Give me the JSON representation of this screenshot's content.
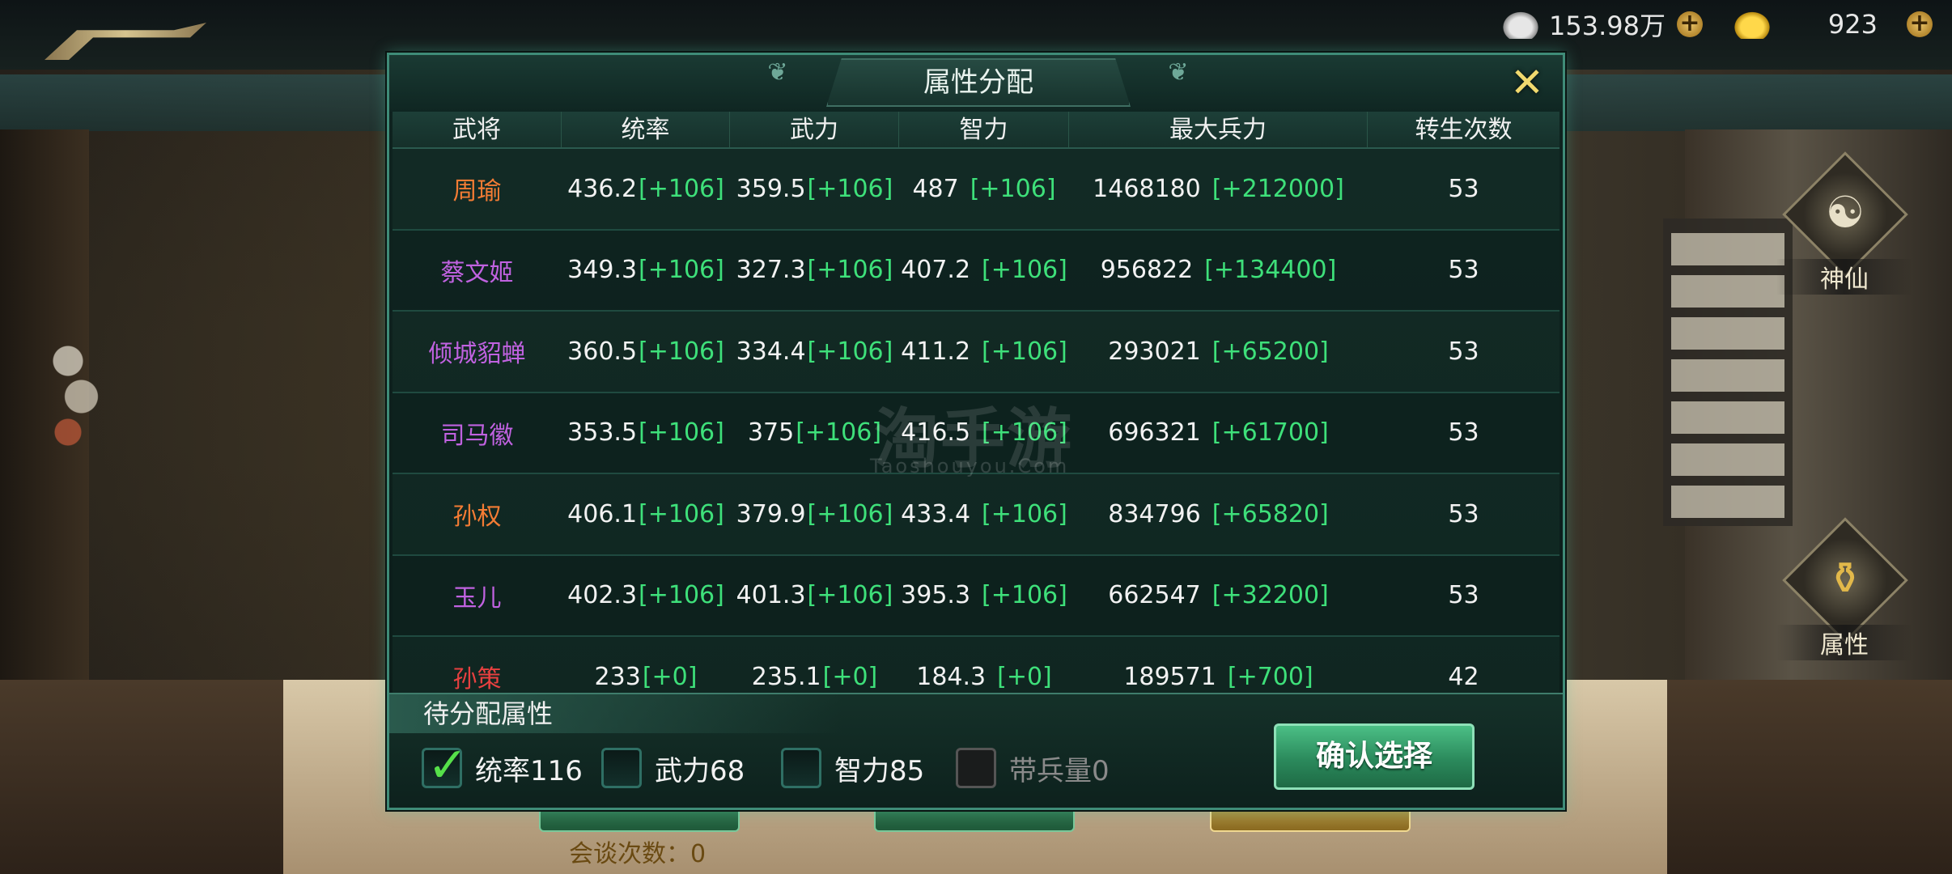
{
  "resources": {
    "silver_value": "153.98万",
    "gold_value": "923"
  },
  "side_buttons": [
    {
      "label": "神仙"
    },
    {
      "label": "属性"
    }
  ],
  "background": {
    "talk_count": "会谈次数：0",
    "watermark": "淘手游",
    "watermark_sub": "Taoshouyou.Com"
  },
  "dialog": {
    "title": "属性分配",
    "close_icon": "close-x-icon",
    "columns": [
      "武将",
      "统率",
      "武力",
      "智力",
      "最大兵力",
      "转生次数"
    ],
    "rows": [
      {
        "name": "周瑜",
        "name_color": "orange",
        "tong": "436.2",
        "tong_bonus": "[+106]",
        "wu": "359.5",
        "wu_bonus": "[+106]",
        "zhi": "487",
        "zhi_bonus": "[+106]",
        "bing": "1468180",
        "bing_bonus": "[+212000]",
        "zhuansheng": "53"
      },
      {
        "name": "蔡文姬",
        "name_color": "purple",
        "tong": "349.3",
        "tong_bonus": "[+106]",
        "wu": "327.3",
        "wu_bonus": "[+106]",
        "zhi": "407.2",
        "zhi_bonus": "[+106]",
        "bing": "956822",
        "bing_bonus": "[+134400]",
        "zhuansheng": "53"
      },
      {
        "name": "倾城貂蝉",
        "name_color": "purple",
        "tong": "360.5",
        "tong_bonus": "[+106]",
        "wu": "334.4",
        "wu_bonus": "[+106]",
        "zhi": "411.2",
        "zhi_bonus": "[+106]",
        "bing": "293021",
        "bing_bonus": "[+65200]",
        "zhuansheng": "53"
      },
      {
        "name": "司马徽",
        "name_color": "purple",
        "tong": "353.5",
        "tong_bonus": "[+106]",
        "wu": "375",
        "wu_bonus": "[+106]",
        "zhi": "416.5",
        "zhi_bonus": "[+106]",
        "bing": "696321",
        "bing_bonus": "[+61700]",
        "zhuansheng": "53"
      },
      {
        "name": "孙权",
        "name_color": "orange",
        "tong": "406.1",
        "tong_bonus": "[+106]",
        "wu": "379.9",
        "wu_bonus": "[+106]",
        "zhi": "433.4",
        "zhi_bonus": "[+106]",
        "bing": "834796",
        "bing_bonus": "[+65820]",
        "zhuansheng": "53"
      },
      {
        "name": "玉儿",
        "name_color": "purple",
        "tong": "402.3",
        "tong_bonus": "[+106]",
        "wu": "401.3",
        "wu_bonus": "[+106]",
        "zhi": "395.3",
        "zhi_bonus": "[+106]",
        "bing": "662547",
        "bing_bonus": "[+32200]",
        "zhuansheng": "53"
      },
      {
        "name": "孙策",
        "name_color": "red",
        "tong": "233",
        "tong_bonus": "[+0]",
        "wu": "235.1",
        "wu_bonus": "[+0]",
        "zhi": "184.3",
        "zhi_bonus": "[+0]",
        "bing": "189571",
        "bing_bonus": "[+700]",
        "zhuansheng": "42"
      }
    ],
    "allocation": {
      "title": "待分配属性",
      "options": [
        {
          "label": "统率116",
          "checked": true,
          "disabled": false
        },
        {
          "label": "武力68",
          "checked": false,
          "disabled": false
        },
        {
          "label": "智力85",
          "checked": false,
          "disabled": false
        },
        {
          "label": "带兵量0",
          "checked": false,
          "disabled": true
        }
      ],
      "confirm_label": "确认选择"
    }
  },
  "colors": {
    "bonus_green": "#3ee07a",
    "orange_name": "#f47c34",
    "purple_name": "#c062e0",
    "red_name": "#e84040"
  }
}
